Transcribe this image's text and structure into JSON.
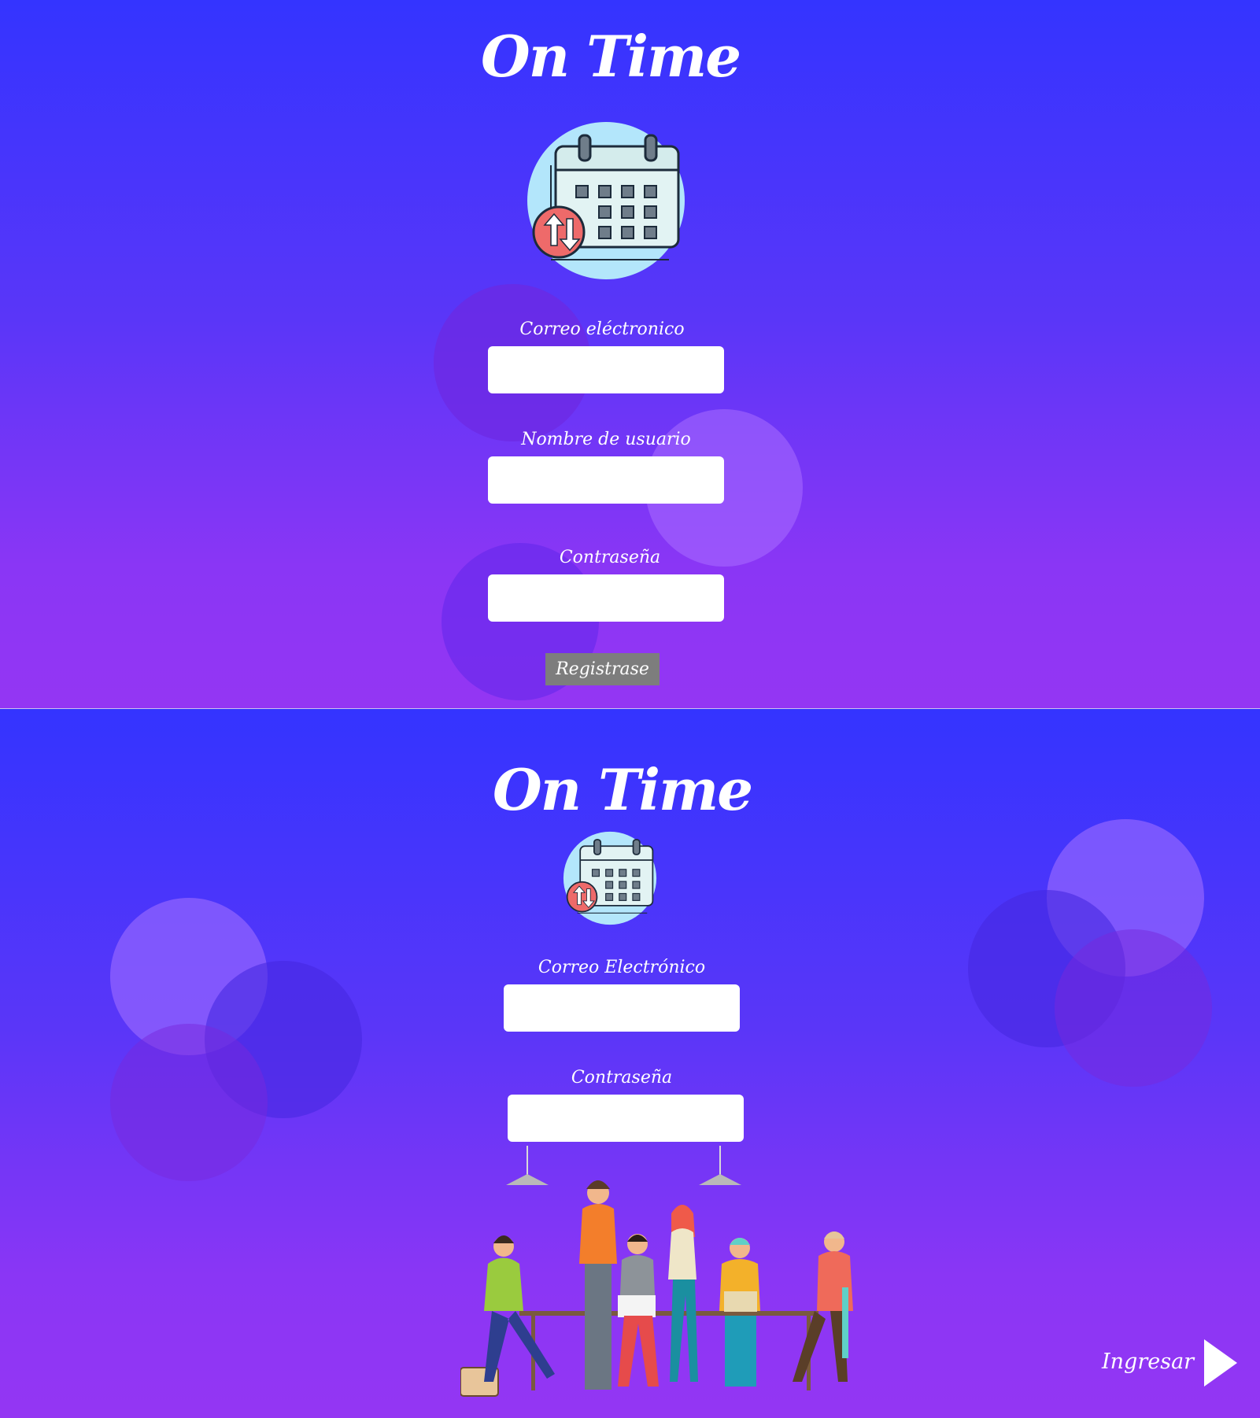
{
  "register_screen": {
    "app_title": "On Time",
    "email_label": "Correo eléctronico",
    "email_value": "",
    "username_label": "Nombre de usuario",
    "username_value": "",
    "password_label": "Contraseña",
    "password_value": "",
    "register_button": "Registrase"
  },
  "login_screen": {
    "app_title": "On Time",
    "email_label": "Correo Electrónico",
    "email_value": "",
    "password_label": "Contraseña",
    "password_value": "",
    "login_link": "Ingresar"
  },
  "icons": [
    "calendar-sync-icon",
    "play-arrow-icon",
    "team-illustration"
  ],
  "colors": {
    "gradient_top": "#3434ff",
    "gradient_bottom": "#9436f3",
    "button": "#7d7d7d"
  }
}
